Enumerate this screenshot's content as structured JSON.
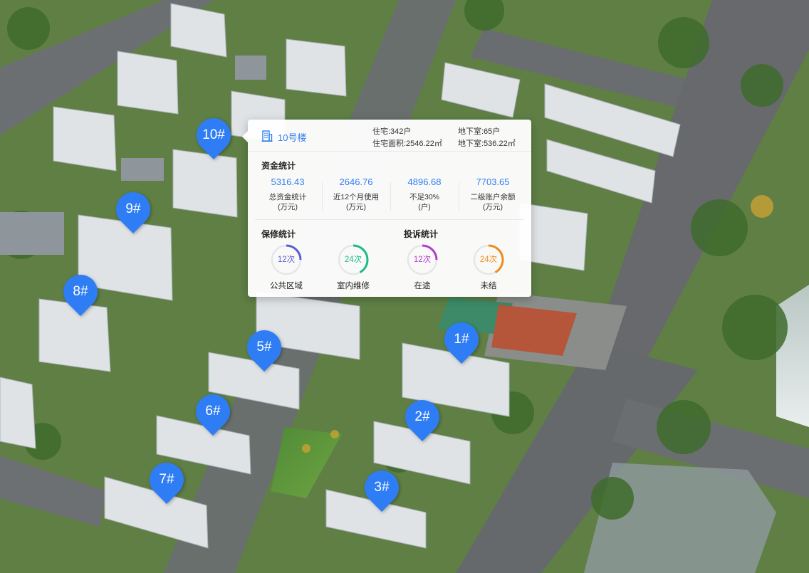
{
  "markers": [
    {
      "label": "10#"
    },
    {
      "label": "9#"
    },
    {
      "label": "8#"
    },
    {
      "label": "5#"
    },
    {
      "label": "1#"
    },
    {
      "label": "6#"
    },
    {
      "label": "2#"
    },
    {
      "label": "7#"
    },
    {
      "label": "3#"
    }
  ],
  "panel": {
    "building_icon": "building-icon",
    "title": "10号楼",
    "stats": {
      "residential_units": "住宅:342户",
      "basement_units": "地下室:65户",
      "residential_area": "住宅面积:2546.22㎡",
      "basement_area": "地下室:536.22㎡"
    },
    "funds": {
      "title": "资金统计",
      "items": [
        {
          "value": "5316.43",
          "label": "总资金统计",
          "unit": "(万元)"
        },
        {
          "value": "2646.76",
          "label": "近12个月使用",
          "unit": "(万元)"
        },
        {
          "value": "4896.68",
          "label": "不足30%",
          "unit": "(户)"
        },
        {
          "value": "7703.65",
          "label": "二级账户余额",
          "unit": "(万元)"
        }
      ]
    },
    "repairs": {
      "title": "保修统计",
      "items": [
        {
          "count": "12次",
          "label": "公共区域",
          "color": "#5b5bd6",
          "fraction": 0.25
        },
        {
          "count": "24次",
          "label": "室内维修",
          "color": "#1cb98a",
          "fraction": 0.42
        }
      ]
    },
    "complaints": {
      "title": "投诉统计",
      "items": [
        {
          "count": "12次",
          "label": "在途",
          "color": "#b23bd1",
          "fraction": 0.25
        },
        {
          "count": "24次",
          "label": "未结",
          "color": "#f08a1a",
          "fraction": 0.42
        }
      ]
    }
  },
  "colors": {
    "accent": "#2f7df4",
    "marker": "#2f7df4"
  }
}
